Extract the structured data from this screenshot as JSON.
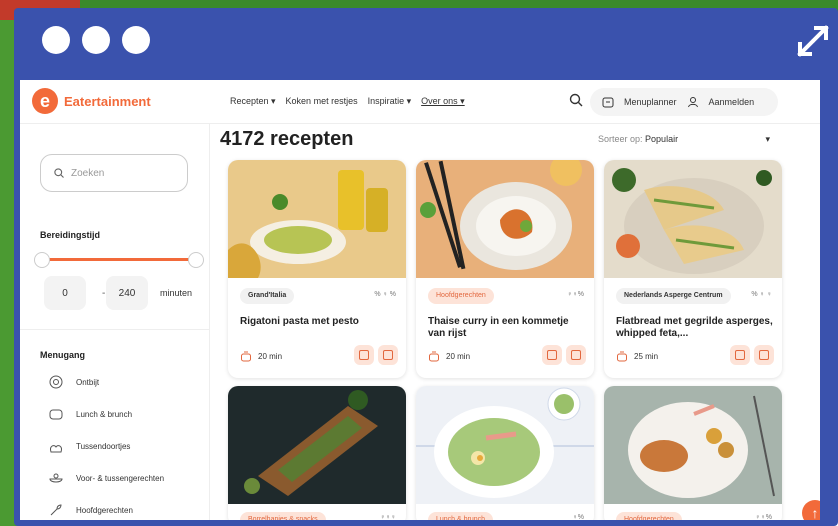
{
  "header": {
    "logo_text": "Eatertainment",
    "logo_letter": "e",
    "nav": [
      "Recepten ▾",
      "Koken met restjes",
      "Inspiratie ▾",
      "Over ons ▾"
    ],
    "menuplanner": "Menuplanner",
    "login": "Aanmelden"
  },
  "sidebar": {
    "search_placeholder": "Zoeken",
    "prep_label": "Bereidingstijd",
    "min_value": "0",
    "max_value": "240",
    "dash": "-",
    "unit": "minuten",
    "menu_label": "Menugang",
    "menu_items": [
      "Ontbijt",
      "Lunch & brunch",
      "Tussendoortjes",
      "Voor- & tussengerechten",
      "Hoofdgerechten"
    ]
  },
  "main": {
    "title": "4172 recepten",
    "sort_label": "Sorteer op:",
    "sort_value": "Populair",
    "sort_caret": "▾",
    "cards": [
      {
        "tag": "Grand'Italia",
        "tag_style": "grey",
        "title": "Rigatoni pasta met pesto",
        "time": "20 min",
        "icons": "% ♀ %"
      },
      {
        "tag": "Hoofdgerechten",
        "tag_style": "orange",
        "title": "Thaise curry in een kommetje van rijst",
        "time": "20 min",
        "icons": "♀♀%"
      },
      {
        "tag": "Nederlands Asperge Centrum",
        "tag_style": "grey",
        "title": "Flatbread met gegrilde asperges, whipped feta,...",
        "time": "25 min",
        "icons": "% ♀ ♀"
      },
      {
        "tag": "Borrelhapjes & snacks",
        "tag_style": "orange",
        "icons": "♀♀♀"
      },
      {
        "tag": "Lunch & brunch",
        "tag_style": "orange",
        "icons": "♀%"
      },
      {
        "tag": "Hoofdgerechten",
        "tag_style": "orange",
        "icons": "♀♀%"
      }
    ],
    "scroll_top": "↑"
  }
}
